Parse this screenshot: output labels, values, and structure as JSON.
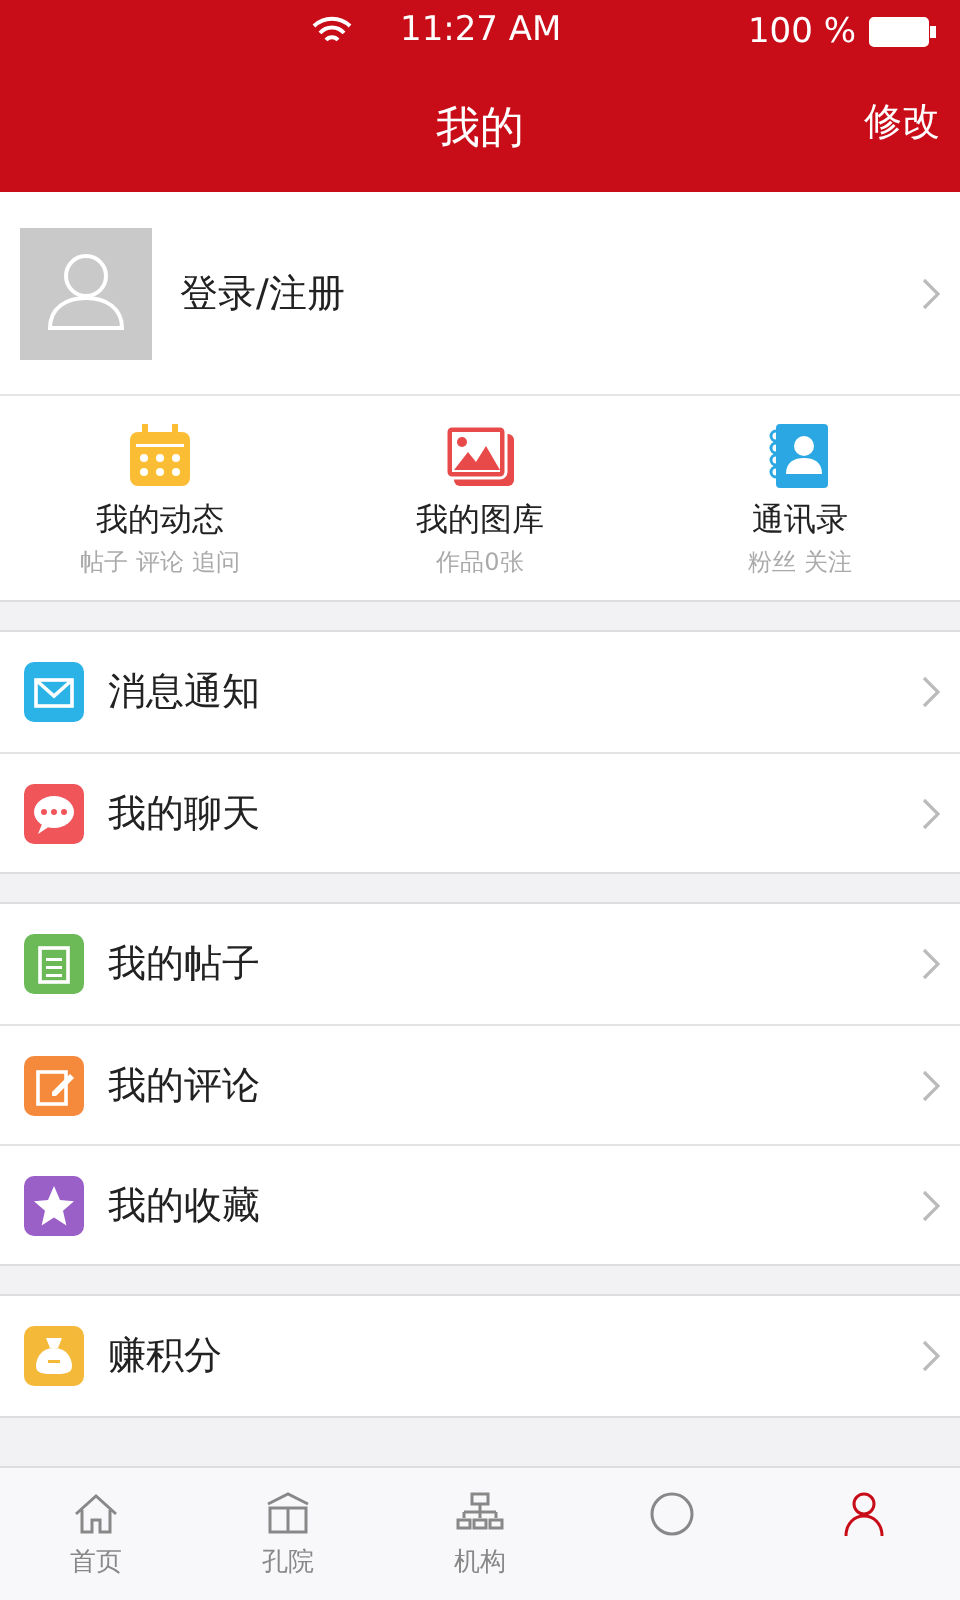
{
  "status_bar": {
    "time": "11:27 AM",
    "battery": "100 %"
  },
  "nav": {
    "title": "我的",
    "action": "修改"
  },
  "profile": {
    "login": "登录/注册"
  },
  "shortcuts": [
    {
      "kind": "calendar",
      "title": "我的动态",
      "subtitle": "帖子 评论 追问"
    },
    {
      "kind": "gallery",
      "title": "我的图库",
      "subtitle": "作品0张"
    },
    {
      "kind": "contacts",
      "title": "通讯录",
      "subtitle": "粉丝 关注"
    }
  ],
  "groups": [
    [
      {
        "kind": "mail",
        "label": "消息通知",
        "color": "#2bb3e8"
      },
      {
        "kind": "chat",
        "label": "我的聊天",
        "color": "#f0555a"
      }
    ],
    [
      {
        "kind": "note",
        "label": "我的帖子",
        "color": "#6cb957"
      },
      {
        "kind": "edit",
        "label": "我的评论",
        "color": "#f58a3c"
      },
      {
        "kind": "star",
        "label": "我的收藏",
        "color": "#9b5fc8"
      }
    ],
    [
      {
        "kind": "bag",
        "label": "赚积分",
        "color": "#f5b93a"
      }
    ]
  ],
  "tab_bar": [
    {
      "kind": "home",
      "label": "首页",
      "selected": false
    },
    {
      "kind": "book",
      "label": "孔院",
      "selected": false
    },
    {
      "kind": "org",
      "label": "机构",
      "selected": false
    },
    {
      "kind": "circle",
      "selected": false
    },
    {
      "kind": "person",
      "selected": true
    }
  ]
}
